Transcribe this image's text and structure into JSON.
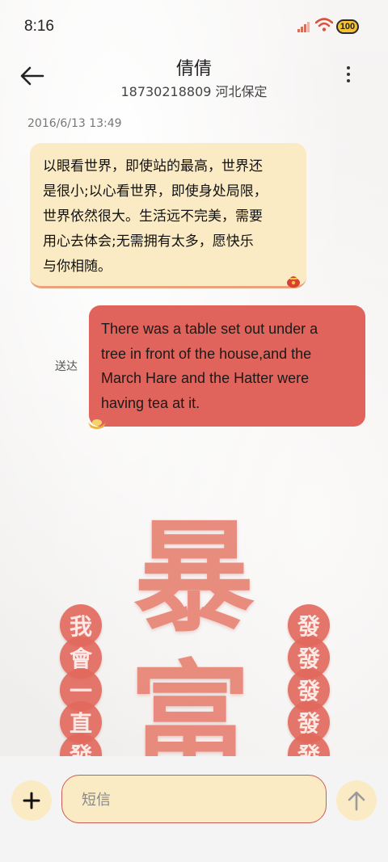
{
  "status_bar": {
    "time": "8:16",
    "battery": "100"
  },
  "header": {
    "name": "倩倩",
    "subtitle": "18730218809 河北保定"
  },
  "conversation": {
    "timestamp": "2016/6/13 13:49",
    "incoming": {
      "lines": [
        "以眼看世界，即使站的最高，世界还",
        "是很小;以心看世界，即使身处局限，",
        "世界依然很大。生活远不完美，需要",
        "用心去体会;无需拥有太多，愿快乐",
        "与你相随。"
      ]
    },
    "outgoing": {
      "lines": [
        "There was a table set out under a",
        "tree in front of the house,and the",
        "March Hare and the Hatter were",
        "having tea at it."
      ],
      "status": "送达"
    }
  },
  "wallpaper": {
    "big_chars": [
      "暴",
      "富"
    ],
    "left_coins": [
      "我",
      "會",
      "一",
      "直",
      "發"
    ],
    "right_coins": [
      "發",
      "發",
      "發",
      "發",
      "發"
    ]
  },
  "composer": {
    "placeholder": "短信"
  },
  "colors": {
    "bubble_incoming": "#fbebc4",
    "bubble_outgoing": "#e0645b",
    "accent": "#c85d54"
  }
}
